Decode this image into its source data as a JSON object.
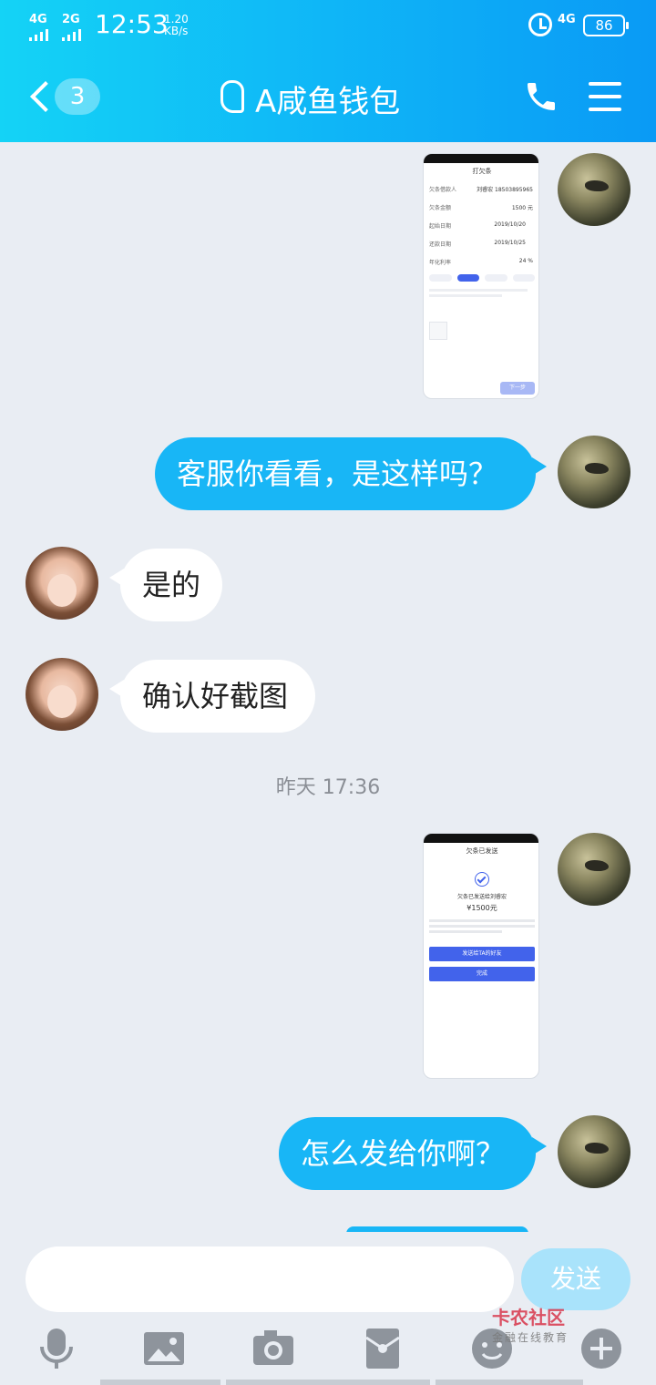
{
  "status_bar": {
    "network1": "4G",
    "network2": "2G",
    "time": "12:53",
    "speed_value": "1.20",
    "speed_unit": "KB/s",
    "network3": "4G",
    "battery": "86"
  },
  "header": {
    "unread_count": "3",
    "title": "A咸鱼钱包"
  },
  "messages": [
    {
      "type": "image",
      "from": "me"
    },
    {
      "type": "text",
      "from": "me",
      "text": "客服你看看，是这样吗？"
    },
    {
      "type": "text",
      "from": "other",
      "text": "是的"
    },
    {
      "type": "text",
      "from": "other",
      "text": "确认好截图"
    },
    {
      "type": "timestamp",
      "text": "昨天 17:36"
    },
    {
      "type": "image",
      "from": "me"
    },
    {
      "type": "text",
      "from": "me",
      "text": "怎么发给你啊？"
    }
  ],
  "shot1": {
    "title": "打欠条",
    "row1_label": "欠条借款人",
    "row1_value": "刘睿宏 18503895965",
    "row2_label": "欠条金额",
    "row2_value": "1500 元",
    "row3_label": "起始日期",
    "row3_value": "2019/10/20",
    "row4_label": "还款日期",
    "row4_value": "2019/10/25",
    "row5_label": "年化利率",
    "row5_value": "24 %",
    "next_button": "下一步"
  },
  "shot2": {
    "title": "欠条已发送",
    "line1": "欠条已发送给刘睿宏",
    "amount": "¥1500元",
    "button1": "发送给TA的好友",
    "button2": "完成"
  },
  "input": {
    "placeholder": "",
    "send_label": "发送"
  },
  "watermark": {
    "brand": "卡农社区",
    "sub": "金融在线教育"
  },
  "icons": [
    "microphone-icon",
    "image-icon",
    "camera-icon",
    "red-packet-icon",
    "emoji-icon",
    "plus-icon"
  ]
}
